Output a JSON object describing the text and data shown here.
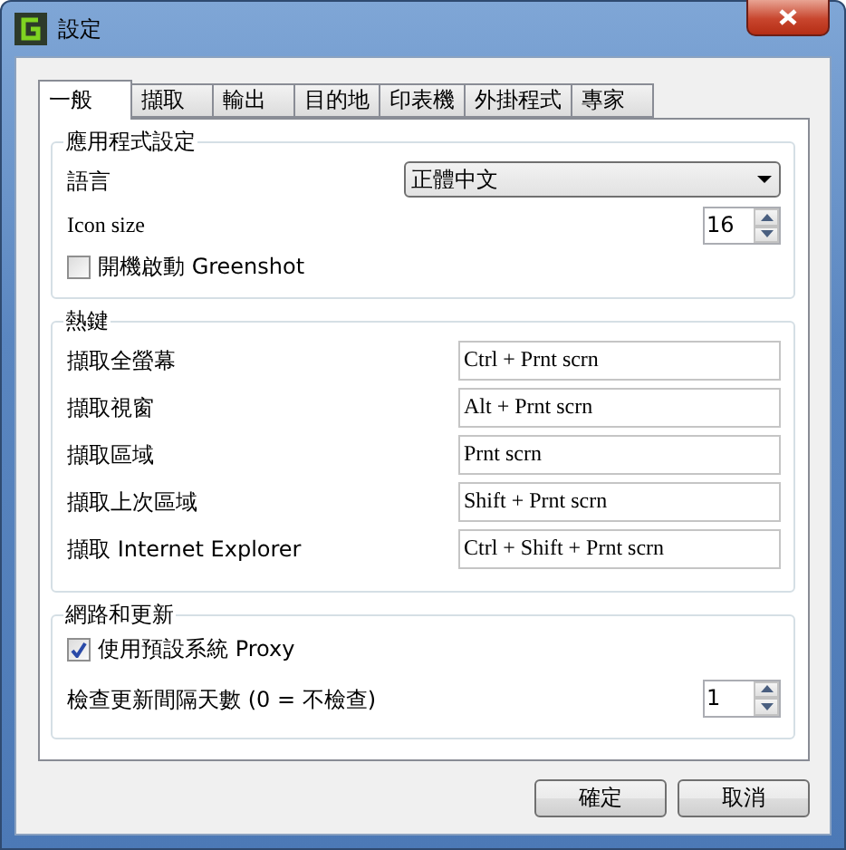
{
  "window": {
    "title": "設定"
  },
  "tabs": [
    {
      "label": "一般",
      "selected": true
    },
    {
      "label": "擷取",
      "selected": false
    },
    {
      "label": "輸出",
      "selected": false
    },
    {
      "label": "目的地",
      "selected": false
    },
    {
      "label": "印表機",
      "selected": false
    },
    {
      "label": "外掛程式",
      "selected": false
    },
    {
      "label": "專家",
      "selected": false
    }
  ],
  "application_settings": {
    "title": "應用程式設定",
    "language": {
      "label": "語言",
      "value": "正體中文"
    },
    "icon_size": {
      "label": "Icon size",
      "value": "16"
    },
    "autostart": {
      "label": "開機啟動 Greenshot",
      "checked": false
    }
  },
  "hotkeys": {
    "title": "熱鍵",
    "rows": [
      {
        "label": "擷取全螢幕",
        "value": "Ctrl + Prnt scrn"
      },
      {
        "label": "擷取視窗",
        "value": "Alt + Prnt scrn"
      },
      {
        "label": "擷取區域",
        "value": "Prnt scrn"
      },
      {
        "label": "擷取上次區域",
        "value": "Shift + Prnt scrn"
      },
      {
        "label": "擷取 Internet Explorer",
        "value": "Ctrl + Shift + Prnt scrn"
      }
    ]
  },
  "network": {
    "title": "網路和更新",
    "proxy": {
      "label": "使用預設系統 Proxy",
      "checked": true
    },
    "update_interval": {
      "label": "檢查更新間隔天數 (0 = 不檢查)",
      "value": "1"
    }
  },
  "buttons": [
    "確定",
    "取消"
  ]
}
